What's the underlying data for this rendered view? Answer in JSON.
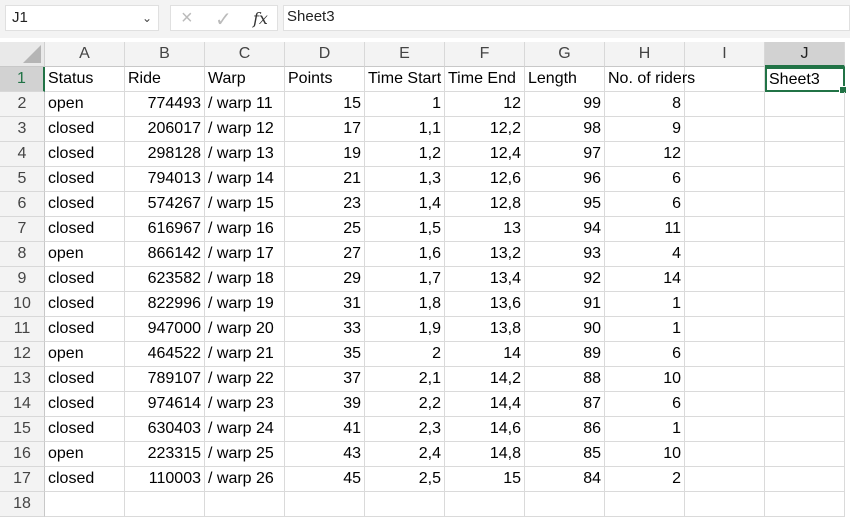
{
  "formula_bar": {
    "name_box": "J1",
    "formula": "Sheet3",
    "cancel_icon": "×",
    "enter_icon": "✓",
    "fx_label": "fx"
  },
  "columns": [
    "A",
    "B",
    "C",
    "D",
    "E",
    "F",
    "G",
    "H",
    "I",
    "J"
  ],
  "selected": {
    "col": "J",
    "row": 1
  },
  "rows": [
    [
      "Status",
      "Ride",
      "Warp",
      "Points",
      "Time Start",
      "Time End",
      "Length",
      "No. of riders",
      "",
      "Sheet3"
    ],
    [
      "open",
      "774493",
      "/ warp 11",
      "15",
      "1",
      "12",
      "99",
      "8",
      "",
      ""
    ],
    [
      "closed",
      "206017",
      "/ warp 12",
      "17",
      "1,1",
      "12,2",
      "98",
      "9",
      "",
      ""
    ],
    [
      "closed",
      "298128",
      "/ warp 13",
      "19",
      "1,2",
      "12,4",
      "97",
      "12",
      "",
      ""
    ],
    [
      "closed",
      "794013",
      "/ warp 14",
      "21",
      "1,3",
      "12,6",
      "96",
      "6",
      "",
      ""
    ],
    [
      "closed",
      "574267",
      "/ warp 15",
      "23",
      "1,4",
      "12,8",
      "95",
      "6",
      "",
      ""
    ],
    [
      "closed",
      "616967",
      "/ warp 16",
      "25",
      "1,5",
      "13",
      "94",
      "11",
      "",
      ""
    ],
    [
      "open",
      "866142",
      "/ warp 17",
      "27",
      "1,6",
      "13,2",
      "93",
      "4",
      "",
      ""
    ],
    [
      "closed",
      "623582",
      "/ warp 18",
      "29",
      "1,7",
      "13,4",
      "92",
      "14",
      "",
      ""
    ],
    [
      "closed",
      "822996",
      "/ warp 19",
      "31",
      "1,8",
      "13,6",
      "91",
      "1",
      "",
      ""
    ],
    [
      "closed",
      "947000",
      "/ warp 20",
      "33",
      "1,9",
      "13,8",
      "90",
      "1",
      "",
      ""
    ],
    [
      "open",
      "464522",
      "/ warp 21",
      "35",
      "2",
      "14",
      "89",
      "6",
      "",
      ""
    ],
    [
      "closed",
      "789107",
      "/ warp 22",
      "37",
      "2,1",
      "14,2",
      "88",
      "10",
      "",
      ""
    ],
    [
      "closed",
      "974614",
      "/ warp 23",
      "39",
      "2,2",
      "14,4",
      "87",
      "6",
      "",
      ""
    ],
    [
      "closed",
      "630403",
      "/ warp 24",
      "41",
      "2,3",
      "14,6",
      "86",
      "1",
      "",
      ""
    ],
    [
      "open",
      "223315",
      "/ warp 25",
      "43",
      "2,4",
      "14,8",
      "85",
      "10",
      "",
      ""
    ],
    [
      "closed",
      "110003",
      "/ warp 26",
      "45",
      "2,5",
      "15",
      "84",
      "2",
      "",
      ""
    ],
    [
      "",
      "",
      "",
      "",
      "",
      "",
      "",
      "",
      "",
      ""
    ]
  ]
}
